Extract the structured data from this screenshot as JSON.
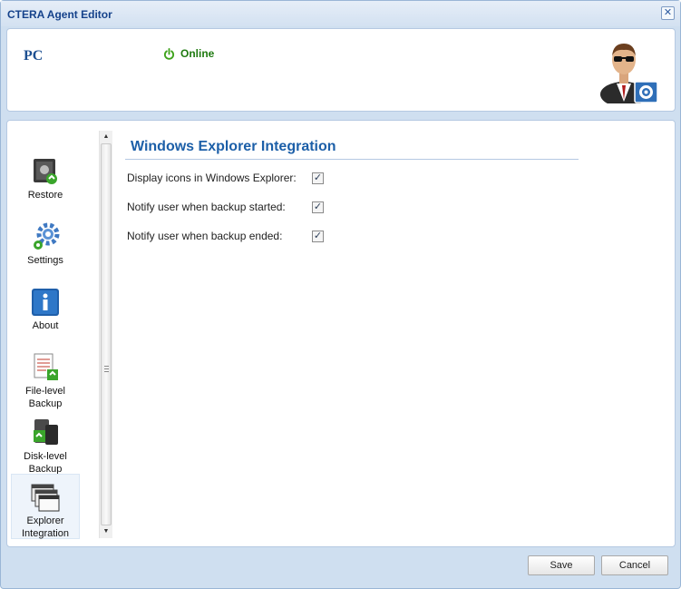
{
  "window": {
    "title": "CTERA Agent Editor"
  },
  "header": {
    "device_name": "PC",
    "status": "Online"
  },
  "nav": {
    "items": [
      {
        "label": "Restore"
      },
      {
        "label": "Settings"
      },
      {
        "label": "About"
      },
      {
        "label": "File-level Backup"
      },
      {
        "label": "Disk-level Backup"
      },
      {
        "label": "Explorer Integration",
        "selected": true
      }
    ]
  },
  "section": {
    "title": "Windows Explorer Integration",
    "options": [
      {
        "label": "Display icons in Windows Explorer:",
        "checked": true
      },
      {
        "label": "Notify user when backup started:",
        "checked": true
      },
      {
        "label": "Notify user when backup ended:",
        "checked": true
      }
    ]
  },
  "footer": {
    "save_label": "Save",
    "cancel_label": "Cancel"
  },
  "colors": {
    "accent": "#1c5fa8",
    "online": "#1f7a10",
    "frame": "#cfdff0"
  }
}
